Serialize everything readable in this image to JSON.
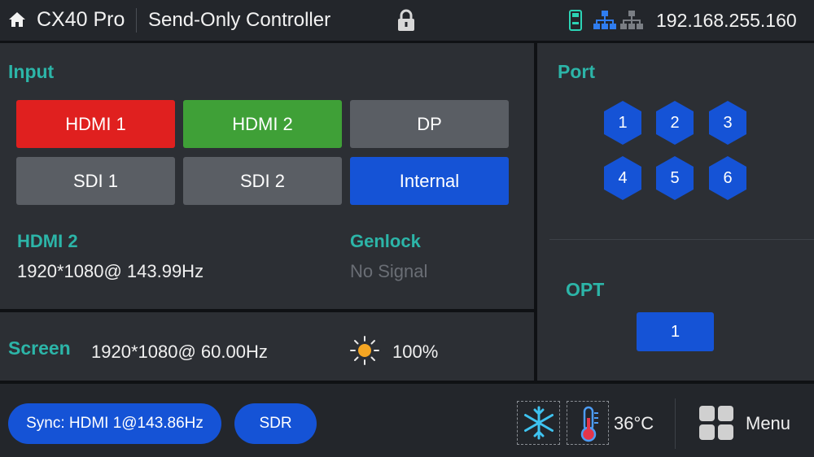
{
  "topbar": {
    "device_name": "CX40 Pro",
    "mode_title": "Send-Only Controller",
    "ip_address": "192.168.255.160",
    "icons": [
      "home-icon",
      "lock-icon",
      "usb-icon",
      "network-icon",
      "network-icon"
    ]
  },
  "input": {
    "title": "Input",
    "sources": [
      {
        "label": "HDMI 1",
        "color": "#e0201f"
      },
      {
        "label": "HDMI 2",
        "color": "#3fa037"
      },
      {
        "label": "DP",
        "color": "#5a5e64"
      },
      {
        "label": "SDI 1",
        "color": "#5a5e64"
      },
      {
        "label": "SDI 2",
        "color": "#5a5e64"
      },
      {
        "label": "Internal",
        "color": "#1553d6"
      }
    ],
    "active_label": "HDMI 2",
    "active_resolution": "1920*1080@ 143.99Hz",
    "genlock_label": "Genlock",
    "genlock_value": "No Signal"
  },
  "screen": {
    "label": "Screen",
    "resolution": "1920*1080@ 60.00Hz",
    "brightness": "100%"
  },
  "port": {
    "title": "Port",
    "ports": [
      "1",
      "2",
      "3",
      "4",
      "5",
      "6"
    ],
    "opt_title": "OPT",
    "opt_ports": [
      "1"
    ]
  },
  "bottom": {
    "sync_label": "Sync: HDMI 1@143.86Hz",
    "sdr_label": "SDR",
    "temperature": "36°C",
    "menu_label": "Menu"
  },
  "colors": {
    "accent": "#2cb5a8",
    "blue": "#1553d6",
    "red": "#e0201f",
    "green": "#3fa037",
    "gray": "#5a5e64"
  }
}
